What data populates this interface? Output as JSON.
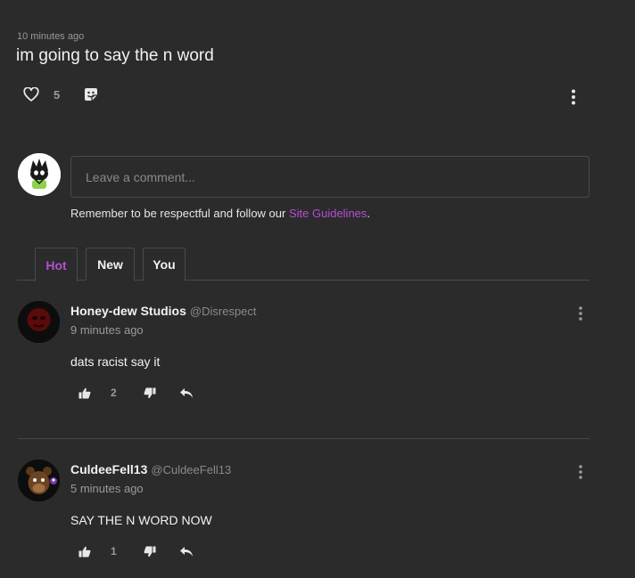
{
  "post": {
    "time": "10 minutes ago",
    "title": "im going to say the n word",
    "like_count": "5"
  },
  "composer": {
    "placeholder": "Leave a comment...",
    "guidelines_prefix": "Remember to be respectful and follow our ",
    "guidelines_link": "Site Guidelines",
    "guidelines_suffix": "."
  },
  "tabs": [
    {
      "label": "Hot",
      "active": true
    },
    {
      "label": "New",
      "active": false
    },
    {
      "label": "You",
      "active": false
    }
  ],
  "comments": [
    {
      "name": "Honey-dew Studios",
      "handle": "@Disrespect",
      "time": "9 minutes ago",
      "body": "dats racist say it",
      "likes": "2"
    },
    {
      "name": "CuldeeFell13",
      "handle": "@CuldeeFell13",
      "time": "5 minutes ago",
      "body": "SAY THE N WORD NOW",
      "likes": "1"
    }
  ],
  "icons": {
    "like": "heart-icon",
    "sticker": "sticker-icon",
    "more": "more-vertical-icon",
    "upvote": "thumbs-up-icon",
    "downvote": "thumbs-down-icon",
    "reply": "reply-icon"
  },
  "colors": {
    "background": "#2b2b2b",
    "accent": "#b44fd0",
    "muted": "#9a9a9a"
  }
}
